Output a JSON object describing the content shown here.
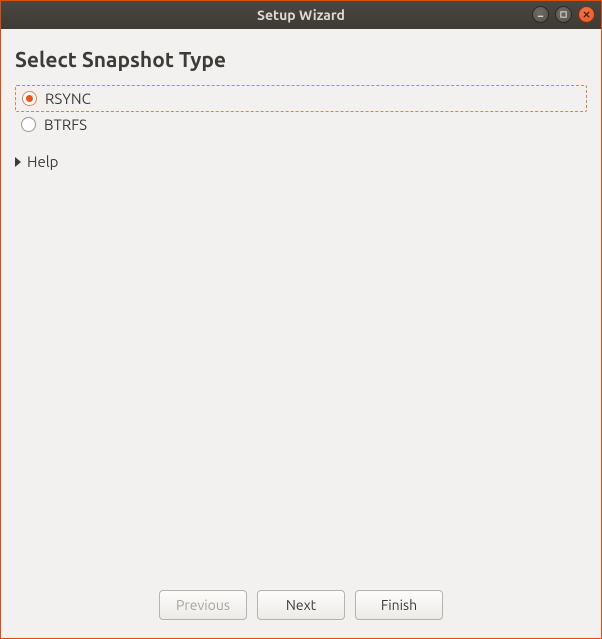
{
  "window": {
    "title": "Setup Wizard"
  },
  "page": {
    "heading": "Select Snapshot Type"
  },
  "options": {
    "rsync": {
      "label": "RSYNC",
      "selected": true
    },
    "btrfs": {
      "label": "BTRFS",
      "selected": false
    }
  },
  "expander": {
    "help_label": "Help",
    "expanded": false
  },
  "footer": {
    "previous_label": "Previous",
    "next_label": "Next",
    "finish_label": "Finish",
    "previous_enabled": false
  }
}
